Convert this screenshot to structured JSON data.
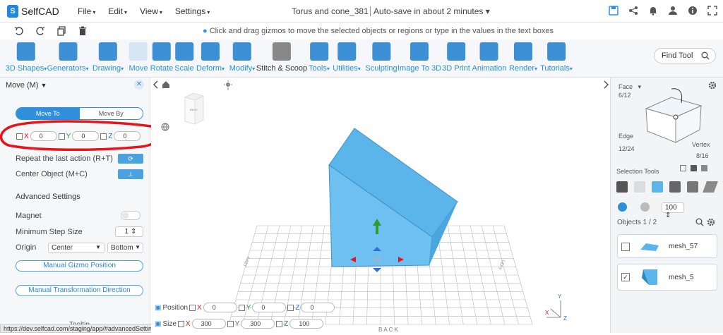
{
  "app": {
    "name": "SelfCAD",
    "logo_letter": "S"
  },
  "menu": [
    "File",
    "Edit",
    "View",
    "Settings"
  ],
  "document": {
    "title": "Torus and cone_381",
    "autosave": "Auto-save in about 2 minutes"
  },
  "hint": "Click and drag gizmos to move the selected objects or regions or type in the values in the text boxes",
  "toolbar": [
    {
      "label": "3D Shapes",
      "dropdown": true
    },
    {
      "label": "Generators",
      "dropdown": true
    },
    {
      "label": "Drawing",
      "dropdown": true
    },
    {
      "label": "Move",
      "dropdown": false
    },
    {
      "label": "Rotate",
      "dropdown": false
    },
    {
      "label": "Scale",
      "dropdown": false
    },
    {
      "label": "Deform",
      "dropdown": true
    },
    {
      "label": "Modify",
      "dropdown": true
    },
    {
      "label": "Stitch & Scoop",
      "dropdown": false
    },
    {
      "label": "Tools",
      "dropdown": true
    },
    {
      "label": "Utilities",
      "dropdown": true
    },
    {
      "label": "Sculpting",
      "dropdown": false
    },
    {
      "label": "Image To 3D",
      "dropdown": false
    },
    {
      "label": "3D Print",
      "dropdown": false
    },
    {
      "label": "Animation",
      "dropdown": false
    },
    {
      "label": "Render",
      "dropdown": true
    },
    {
      "label": "Tutorials",
      "dropdown": true
    }
  ],
  "find_tool": "Find Tool",
  "left_panel": {
    "title": "Move (M)",
    "tab_move_to": "Move To",
    "tab_move_by": "Move By",
    "x_label": "X",
    "y_label": "Y",
    "z_label": "Z",
    "x_value": "0",
    "y_value": "0",
    "z_value": "0",
    "repeat_label": "Repeat the last action (R+T)",
    "center_label": "Center Object (M+C)",
    "advanced_label": "Advanced Settings",
    "magnet_label": "Magnet",
    "min_step_label": "Minimum Step Size",
    "min_step_value": "1",
    "origin_label": "Origin",
    "origin_h": "Center",
    "origin_v": "Bottom",
    "manual_gizmo": "Manual Gizmo Position",
    "manual_dir": "Manual Transformation Direction",
    "tooltip": "Tooltip"
  },
  "status_url": "https://dev.selfcad.com/staging/app/#advancedSettingsPanelMove",
  "viewport": {
    "back_label": "BACK",
    "position_label": "Position",
    "size_label": "Size",
    "pos_x": "0",
    "pos_y": "0",
    "pos_z": "0",
    "size_x": "300",
    "size_y": "300",
    "size_z": "100",
    "axis_x": "X",
    "axis_y": "Y",
    "axis_z": "Z",
    "ground_back": "BACK",
    "ground_left": "LEFT",
    "ground_right": "LEFT"
  },
  "right_panel": {
    "face_label": "Face",
    "face_count": "6/12",
    "edge_label": "Edge",
    "edge_count": "12/24",
    "vertex_label": "Vertex",
    "vertex_count": "8/16",
    "selection_tools": "Selection Tools",
    "brush_size": "100",
    "objects_label": "Objects 1 / 2",
    "objects": [
      {
        "name": "mesh_57",
        "checked": false
      },
      {
        "name": "mesh_5",
        "checked": true
      }
    ]
  },
  "colors": {
    "accent": "#2f8fdb",
    "mesh": "#5bb4ea",
    "annotation": "#e8141c"
  }
}
